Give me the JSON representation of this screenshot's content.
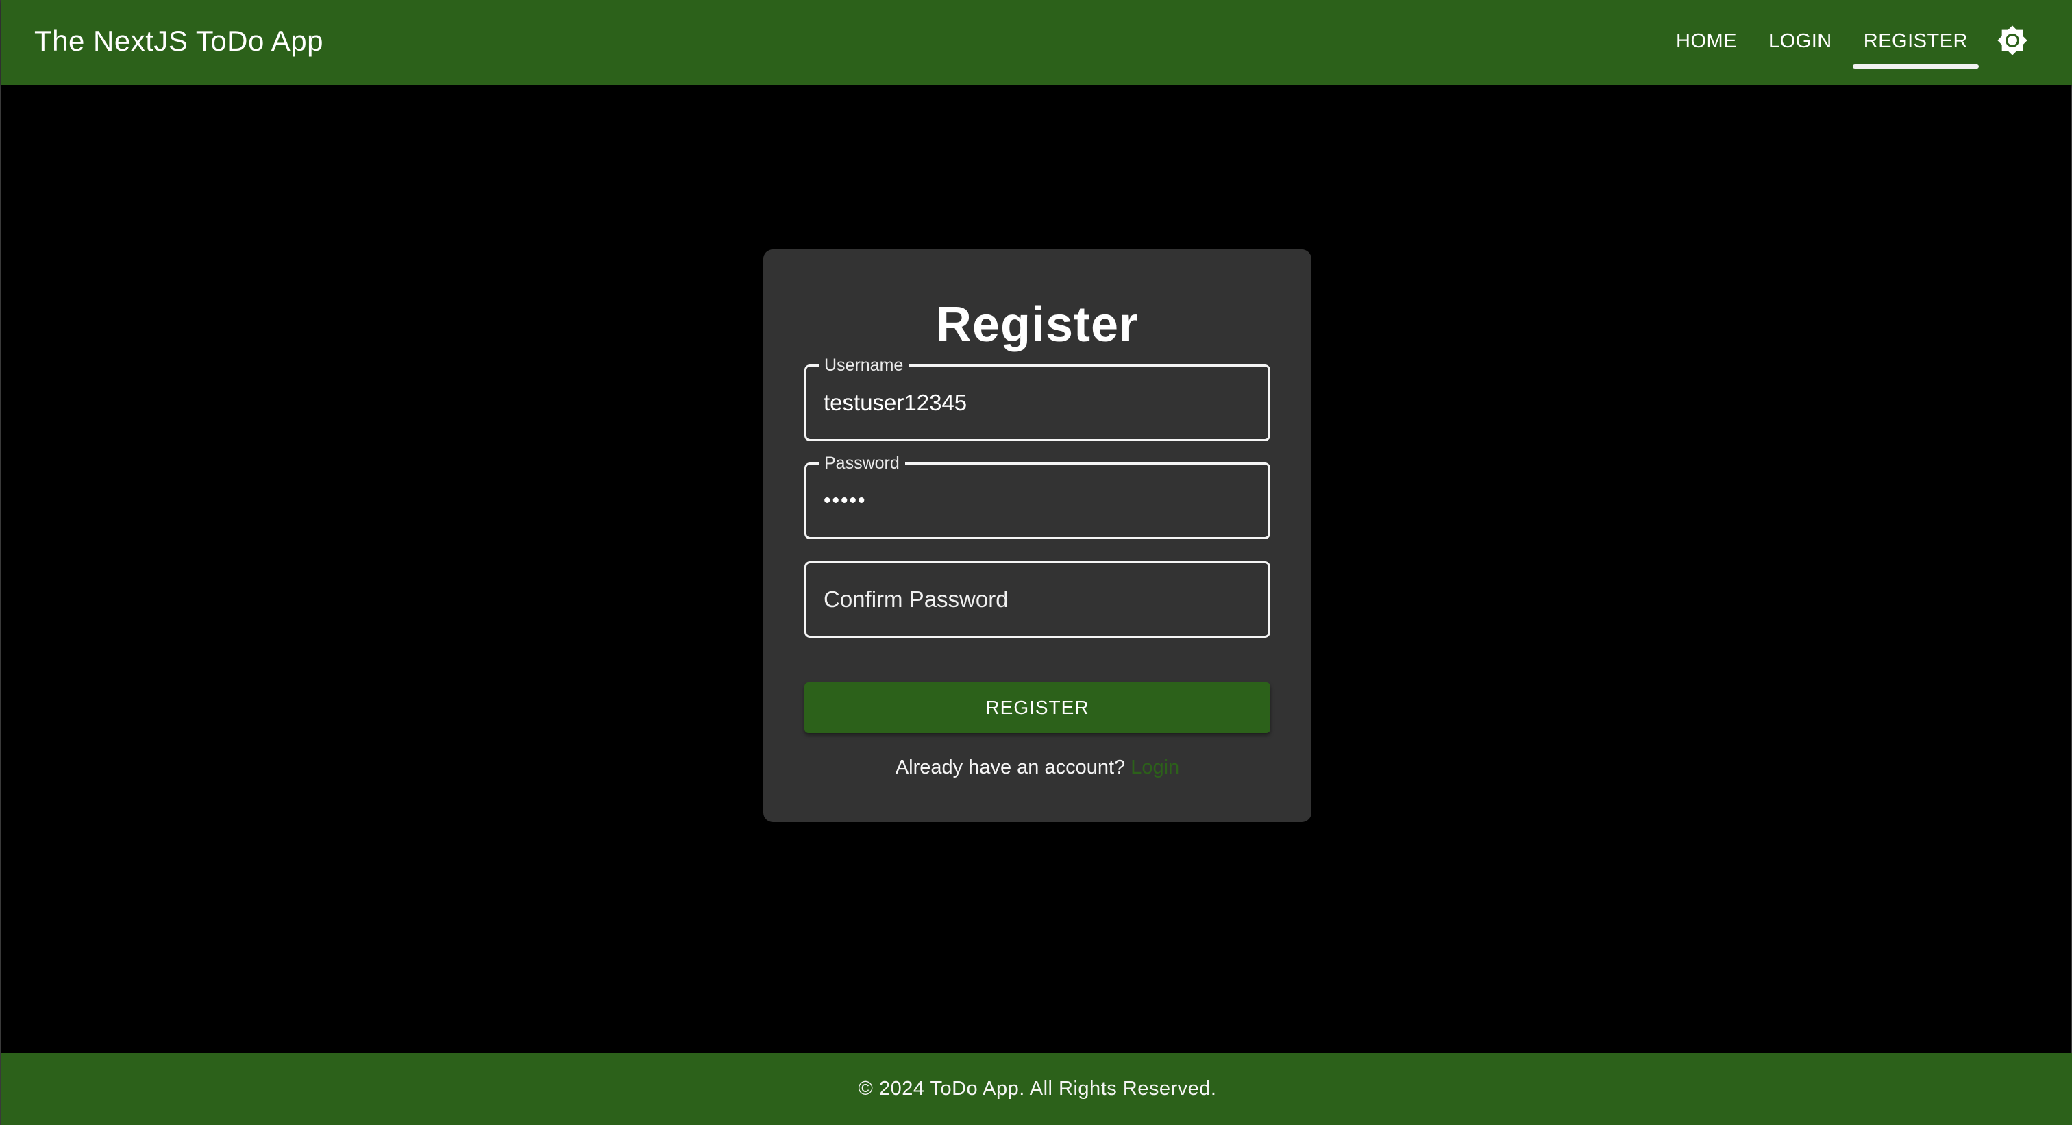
{
  "app": {
    "title": "The NextJS ToDo App",
    "brand_color": "#2c611a",
    "background_color": "#000000",
    "card_color": "#333333"
  },
  "nav": {
    "items": [
      {
        "label": "HOME",
        "active": false
      },
      {
        "label": "LOGIN",
        "active": false
      },
      {
        "label": "REGISTER",
        "active": true
      }
    ],
    "theme_toggle_icon": "brightness-icon"
  },
  "form": {
    "title": "Register",
    "username": {
      "label": "Username",
      "value": "testuser12345"
    },
    "password": {
      "label": "Password",
      "value": "•••••"
    },
    "confirm_password": {
      "placeholder": "Confirm Password",
      "value": ""
    },
    "submit_label": "REGISTER",
    "already_text": "Already have an account?",
    "login_link": "Login"
  },
  "footer": {
    "text": "© 2024 ToDo App. All Rights Reserved."
  }
}
